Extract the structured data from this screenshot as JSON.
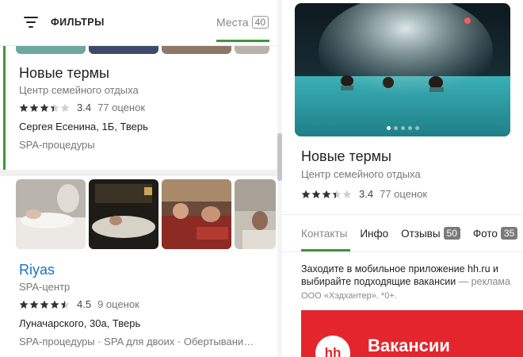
{
  "filter": {
    "label": "ФИЛЬТРЫ",
    "places_label": "Места",
    "places_count": "40"
  },
  "results": [
    {
      "title": "Новые термы",
      "subtitle": "Центр семейного отдыха",
      "rating": 3.4,
      "rating_text": "3.4",
      "reviews": "77 оценок",
      "address": "Сергея Есенина, 1Б, Тверь",
      "category": "SPA-процедуры"
    },
    {
      "title": "Riyas",
      "subtitle": "SPA-центр",
      "rating": 4.5,
      "rating_text": "4.5",
      "reviews": "9 оценок",
      "address": "Луначарского, 30а, Тверь",
      "category": "SPA-процедуры · SPA для двоих · Обертывани…"
    }
  ],
  "detail": {
    "title": "Новые термы",
    "subtitle": "Центр семейного отдыха",
    "rating": 3.4,
    "rating_text": "3.4",
    "reviews": "77 оценок",
    "photo_dots": 5,
    "active_dot": 0,
    "tabs": [
      {
        "label": "Контакты",
        "badge": ""
      },
      {
        "label": "Инфо",
        "badge": ""
      },
      {
        "label": "Отзывы",
        "badge": "50"
      },
      {
        "label": "Фото",
        "badge": "35"
      }
    ]
  },
  "ad": {
    "text": "Заходите в мобильное приложение hh.ru и выбирайте подходящие вакансии",
    "tag": " — реклама",
    "legal": "ООО «Хэдхантер». *0+.",
    "logo": "hh",
    "banner_text": "Вакансии"
  },
  "colors": {
    "accent": "#3a9a3a",
    "link": "#1a73c8",
    "star": "#333333",
    "ad_red": "#e4252c"
  }
}
